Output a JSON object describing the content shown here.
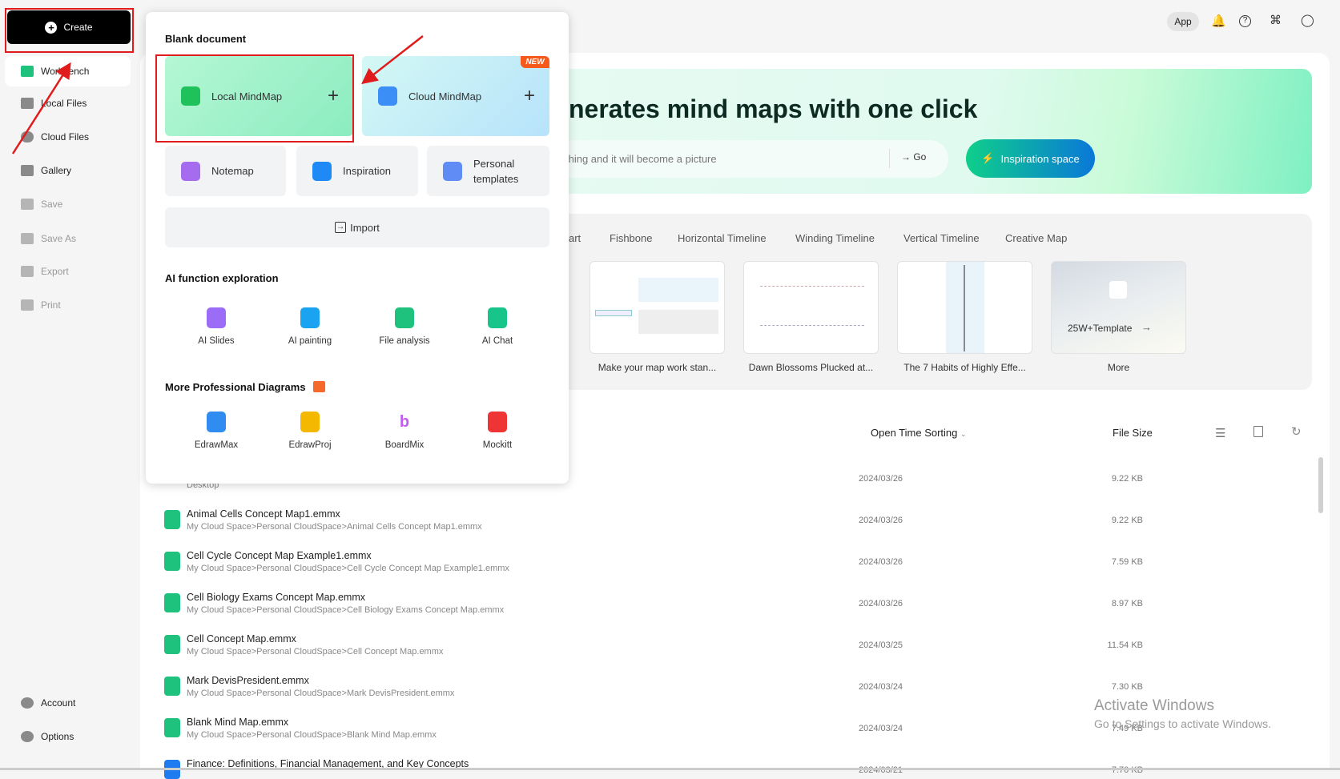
{
  "sidebar": {
    "create_label": "Create",
    "items": [
      {
        "label": "Workbench",
        "icon": "workbench-icon"
      },
      {
        "label": "Local Files",
        "icon": "folder-icon"
      },
      {
        "label": "Cloud Files",
        "icon": "cloud-icon"
      },
      {
        "label": "Gallery",
        "icon": "gallery-icon"
      },
      {
        "label": "Save",
        "icon": "save-icon"
      },
      {
        "label": "Save As",
        "icon": "save-as-icon"
      },
      {
        "label": "Export",
        "icon": "export-icon"
      },
      {
        "label": "Print",
        "icon": "print-icon"
      }
    ],
    "bottom": [
      {
        "label": "Account",
        "icon": "account-icon"
      },
      {
        "label": "Options",
        "icon": "gear-icon"
      }
    ]
  },
  "topbar": {
    "app_label": "App",
    "icons": [
      "bell-icon",
      "help-icon",
      "apps-icon",
      "skin-icon"
    ]
  },
  "hero": {
    "title": "nerates mind maps with one click",
    "placeholder": "thing and it will become a picture",
    "go_label": "Go",
    "inspiration_label": "Inspiration space"
  },
  "templates": {
    "tabs": [
      "art",
      "Fishbone",
      "Horizontal Timeline",
      "Winding Timeline",
      "Vertical Timeline",
      "Creative Map"
    ],
    "items": [
      {
        "caption": "Make your map work stan..."
      },
      {
        "caption": "Dawn Blossoms Plucked at..."
      },
      {
        "caption": "The 7 Habits of Highly Effe..."
      },
      {
        "caption": "More",
        "overlay": "25W+Template"
      }
    ]
  },
  "files": {
    "sort_label": "Open Time Sorting",
    "size_header": "File Size",
    "rows": [
      {
        "name": "",
        "path": "Desktop",
        "date": "2024/03/26",
        "size": "9.22 KB"
      },
      {
        "name": "Animal Cells Concept Map1.emmx",
        "path": "My Cloud Space>Personal CloudSpace>Animal Cells Concept Map1.emmx",
        "date": "2024/03/26",
        "size": "9.22 KB"
      },
      {
        "name": "Cell Cycle Concept Map Example1.emmx",
        "path": "My Cloud Space>Personal CloudSpace>Cell Cycle Concept Map Example1.emmx",
        "date": "2024/03/26",
        "size": "7.59 KB"
      },
      {
        "name": "Cell Biology Exams Concept Map.emmx",
        "path": "My Cloud Space>Personal CloudSpace>Cell Biology Exams Concept Map.emmx",
        "date": "2024/03/26",
        "size": "8.97 KB"
      },
      {
        "name": "Cell Concept Map.emmx",
        "path": "My Cloud Space>Personal CloudSpace>Cell Concept Map.emmx",
        "date": "2024/03/25",
        "size": "11.54 KB"
      },
      {
        "name": "Mark DevisPresident.emmx",
        "path": "My Cloud Space>Personal CloudSpace>Mark DevisPresident.emmx",
        "date": "2024/03/24",
        "size": "7.30 KB"
      },
      {
        "name": "Blank Mind Map.emmx",
        "path": "My Cloud Space>Personal CloudSpace>Blank Mind Map.emmx",
        "date": "2024/03/24",
        "size": "7.49 KB"
      },
      {
        "name": "Finance: Definitions, Financial Management, and Key Concepts",
        "path": "",
        "date": "2024/03/21",
        "size": "7.70 KB"
      }
    ]
  },
  "popup": {
    "blank_heading": "Blank document",
    "local_label": "Local MindMap",
    "cloud_label": "Cloud MindMap",
    "new_badge": "NEW",
    "notemap_label": "Notemap",
    "inspiration_label": "Inspiration",
    "personal_label_1": "Personal",
    "personal_label_2": "templates",
    "import_label": "Import",
    "ai_heading": "AI function exploration",
    "ai_tools": [
      {
        "label": "AI Slides",
        "color": "#9b6cf5"
      },
      {
        "label": "AI painting",
        "color": "#1aa3f0"
      },
      {
        "label": "File analysis",
        "color": "#1fc27d"
      },
      {
        "label": "AI Chat",
        "color": "#17c48a"
      }
    ],
    "more_heading": "More Professional Diagrams",
    "more_tools": [
      {
        "label": "EdrawMax",
        "color": "#2f8cf0"
      },
      {
        "label": "EdrawProj",
        "color": "#f5b800"
      },
      {
        "label": "BoardMix",
        "color": "#c35cf0"
      },
      {
        "label": "Mockitt",
        "color": "#ee3434"
      }
    ]
  },
  "watermark": {
    "line1": "Activate Windows",
    "line2": "Go to Settings to activate Windows."
  },
  "colors": {
    "highlight": "#e01b1b",
    "accent": "#1fc27d"
  }
}
